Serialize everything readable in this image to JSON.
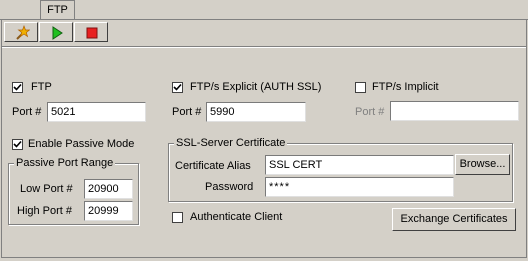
{
  "tab": {
    "label": "FTP"
  },
  "toolbar": {
    "icons": [
      "wizard-icon",
      "play-icon",
      "stop-icon"
    ]
  },
  "ftp": {
    "checkbox_label": "FTP",
    "checked": true,
    "port_label": "Port #",
    "port_value": "5021",
    "passive_label": "Enable Passive Mode",
    "passive_checked": true,
    "passive_range": {
      "title": "Passive Port Range",
      "low_label": "Low Port #",
      "low_value": "20900",
      "high_label": "High Port #",
      "high_value": "20999"
    }
  },
  "ftps_explicit": {
    "checkbox_label": "FTP/s Explicit (AUTH SSL)",
    "checked": true,
    "port_label": "Port #",
    "port_value": "5990"
  },
  "ftps_implicit": {
    "checkbox_label": "FTP/s Implicit",
    "checked": false,
    "port_label": "Port #",
    "port_value": ""
  },
  "ssl": {
    "title": "SSL-Server Certificate",
    "alias_label": "Certificate Alias",
    "alias_value": "SSL CERT",
    "browse_label": "Browse...",
    "password_label": "Password",
    "password_value": "****"
  },
  "auth_client": {
    "label": "Authenticate Client",
    "checked": false
  },
  "exchange_label": "Exchange Certificates"
}
